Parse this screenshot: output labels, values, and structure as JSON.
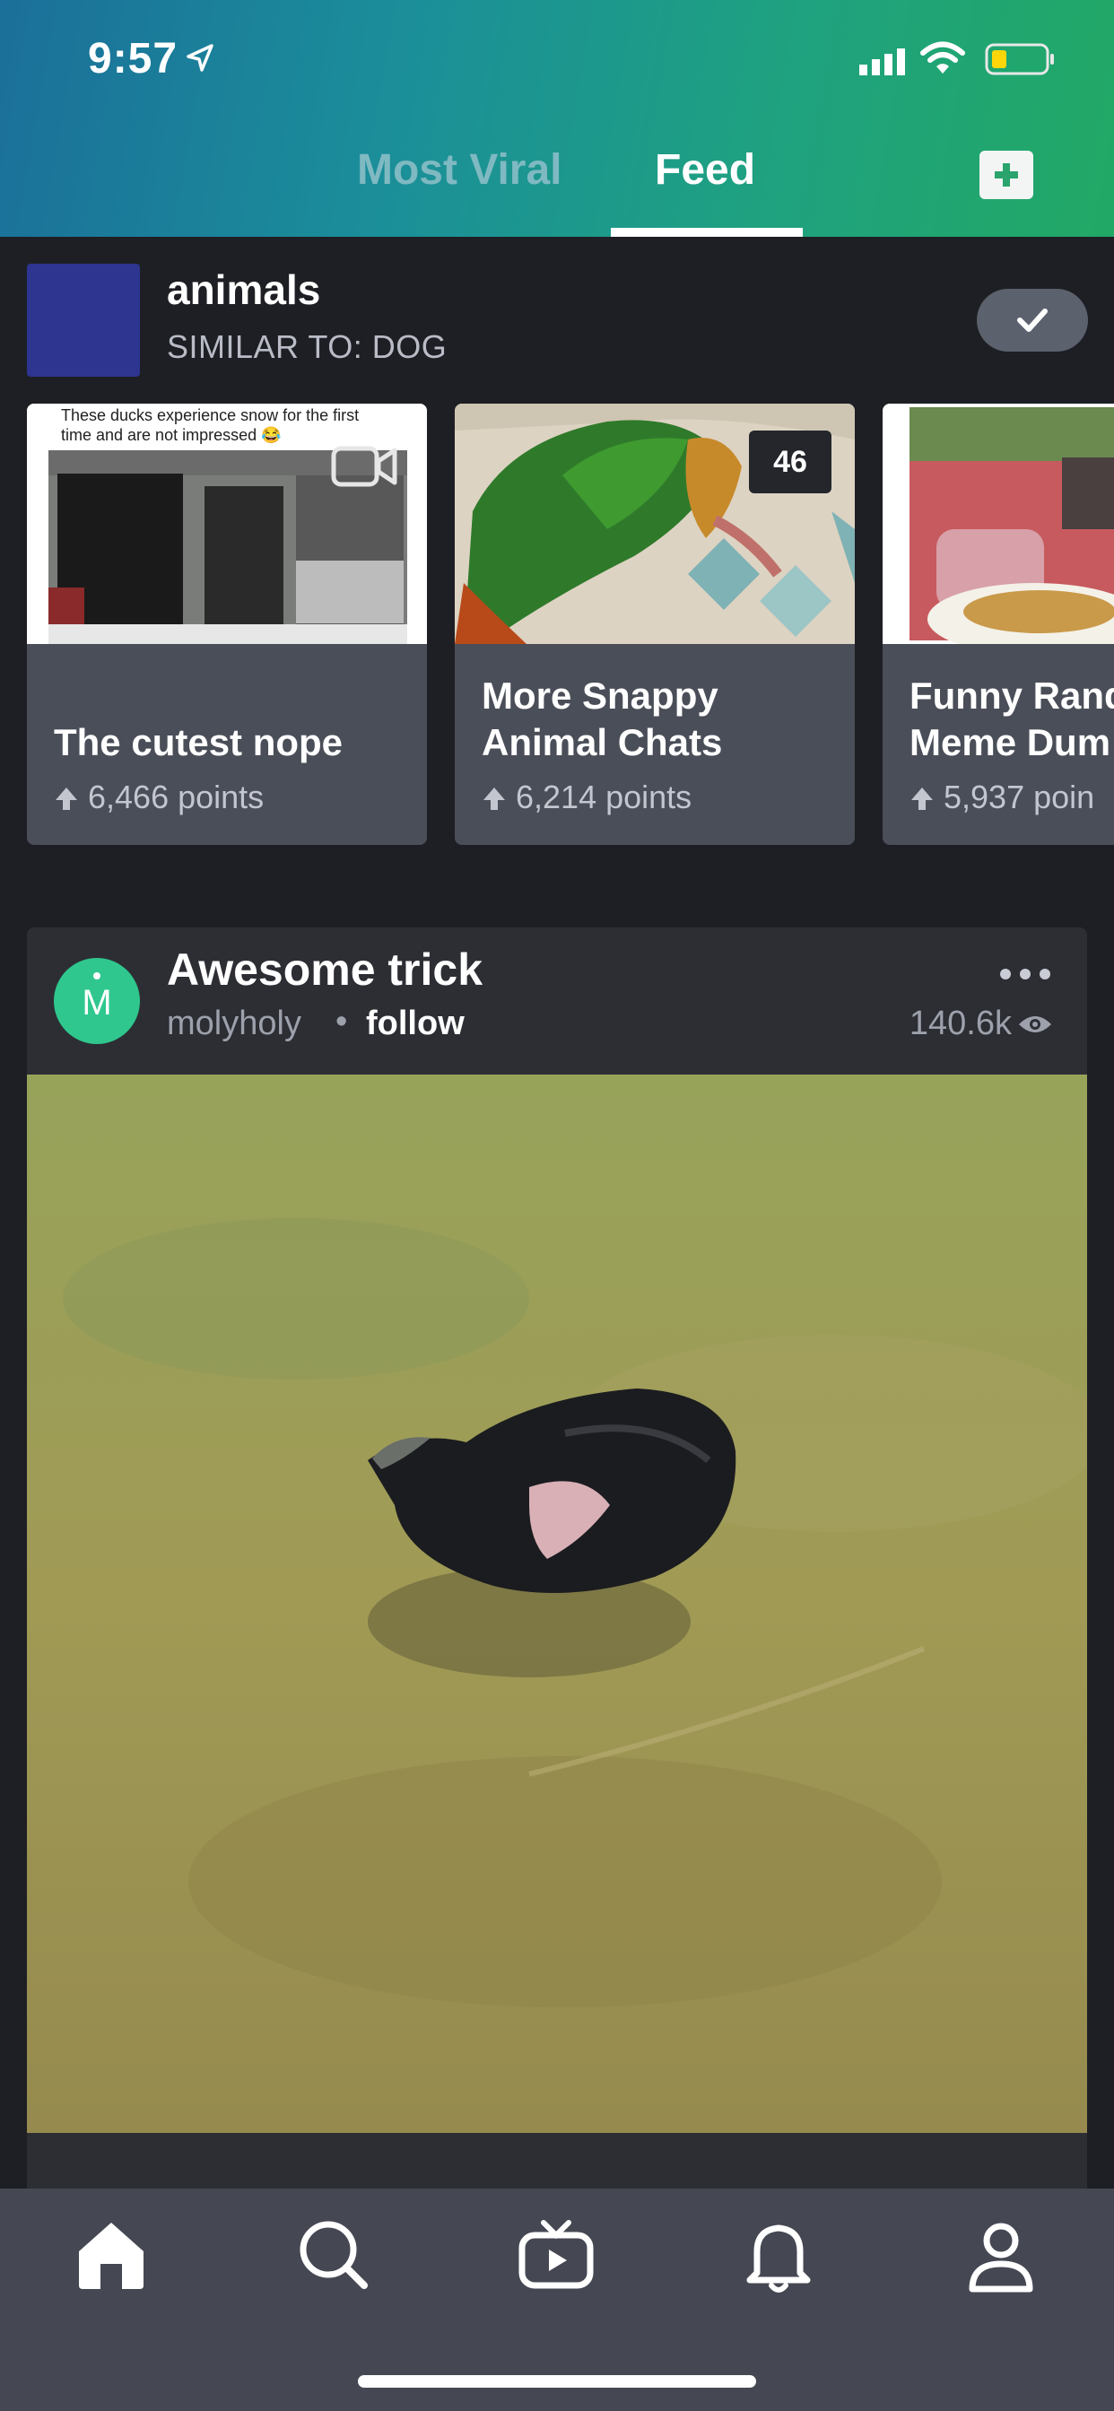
{
  "status_bar": {
    "time": "9:57"
  },
  "header": {
    "tabs": [
      {
        "label": "Most Viral",
        "active": false
      },
      {
        "label": "Feed",
        "active": true
      }
    ],
    "gradient_colors": [
      "#1b6f9a",
      "#22a865"
    ]
  },
  "tag": {
    "name": "animals",
    "similar": "SIMILAR TO: DOG",
    "following": true
  },
  "cards": [
    {
      "title_lines": [
        "The cutest nope"
      ],
      "points": "6,466 points",
      "caption": "These ducks experience snow for the first time and are not impressed 😂",
      "media": "video-icon"
    },
    {
      "title_lines": [
        "More Snappy",
        "Animal Chats"
      ],
      "points": "6,214 points",
      "count": "46"
    },
    {
      "title_lines": [
        "Funny Rand",
        "Meme Dum"
      ],
      "points": "5,937 poin"
    }
  ],
  "post": {
    "avatar_letter": "M",
    "avatar_color": "#2fc78e",
    "title": "Awesome trick",
    "author": "molyholy",
    "separator": "•",
    "follow": "follow",
    "views": "140.6k"
  },
  "tabbar": {
    "items": [
      "home-icon",
      "search-icon",
      "video-tv-icon",
      "bell-icon",
      "profile-icon"
    ],
    "active": "home-icon"
  }
}
